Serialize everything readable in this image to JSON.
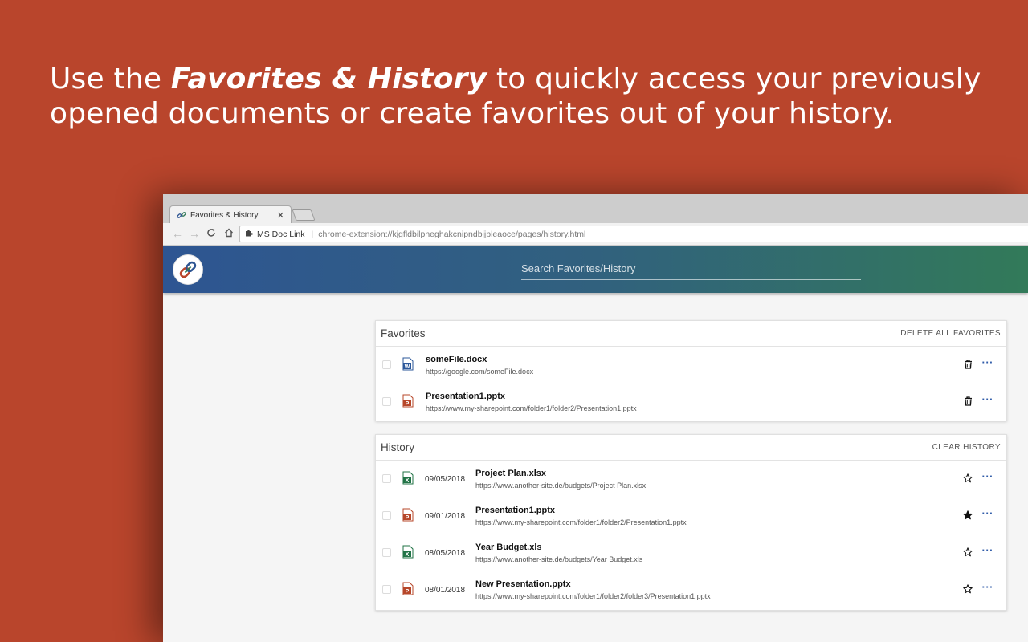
{
  "headline": {
    "prefix": "Use the ",
    "emphasis": "Favorites & History",
    "suffix": " to quickly access your previously opened documents or create favorites out of your history."
  },
  "browser": {
    "tab_title": "Favorites & History",
    "close_glyph": "✕",
    "extension_name": "MS Doc Link",
    "url": "chrome-extension://kjgfldbilpneghakcnipndbjjpleaoce/pages/history.html"
  },
  "app": {
    "search_placeholder": "Search Favorites/History"
  },
  "favorites": {
    "title": "Favorites",
    "action": "DELETE ALL FAVORITES",
    "items": [
      {
        "type": "word",
        "name": "someFile.docx",
        "url": "https://google.com/someFile.docx"
      },
      {
        "type": "powerpoint",
        "name": "Presentation1.pptx",
        "url": "https://www.my-sharepoint.com/folder1/folder2/Presentation1.pptx"
      }
    ]
  },
  "history": {
    "title": "History",
    "action": "CLEAR HISTORY",
    "items": [
      {
        "type": "excel",
        "date": "09/05/2018",
        "name": "Project Plan.xlsx",
        "url": "https://www.another-site.de/budgets/Project Plan.xlsx",
        "favorite": false
      },
      {
        "type": "powerpoint",
        "date": "09/01/2018",
        "name": "Presentation1.pptx",
        "url": "https://www.my-sharepoint.com/folder1/folder2/Presentation1.pptx",
        "favorite": true
      },
      {
        "type": "excel",
        "date": "08/05/2018",
        "name": "Year Budget.xls",
        "url": "https://www.another-site.de/budgets/Year Budget.xls",
        "favorite": false
      },
      {
        "type": "powerpoint",
        "date": "08/01/2018",
        "name": "New Presentation.pptx",
        "url": "https://www.my-sharepoint.com/folder1/folder2/folder3/Presentation1.pptx",
        "favorite": false
      }
    ]
  },
  "icons": {
    "word_letter": "W",
    "excel_letter": "X",
    "powerpoint_letter": "P",
    "more_glyph": "···",
    "colors": {
      "word": "#2b579a",
      "excel": "#217346",
      "powerpoint": "#b7472a",
      "accent": "#2e5aa8",
      "background": "#b9452c"
    }
  }
}
